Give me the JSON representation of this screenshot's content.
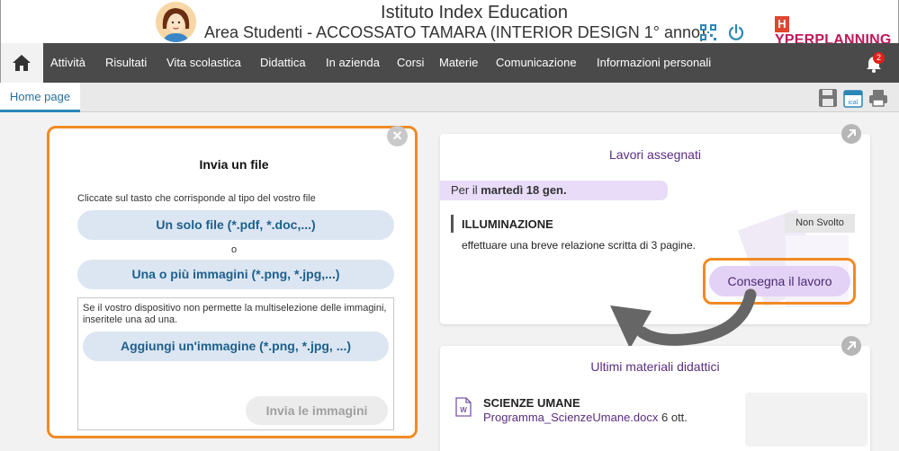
{
  "header": {
    "institute": "Istituto Index Education",
    "area": "Area Studenti - ACCOSSATO TAMARA (INTERIOR DESIGN  1° anno)",
    "brand_initial": "H",
    "brand_rest": "YPERPLANNING",
    "notifications_count": "2"
  },
  "nav": {
    "items": [
      "Attività",
      "Risultati",
      "Vita scolastica",
      "Didattica",
      "In azienda",
      "Corsi",
      "Materie",
      "Comunicazione",
      "Informazioni personali"
    ]
  },
  "subnav": {
    "tab": "Home page"
  },
  "dialog": {
    "title": "Invia un file",
    "hint": "Cliccate sul tasto che corrisponde al tipo del vostro file",
    "single_file": "Un solo file (*.pdf, *.doc,...)",
    "or": "o",
    "images": "Una o più immagini (*.png, *.jpg,...)",
    "note": "Se il vostro dispositivo non permette la multiselezione delle immagini, inseritele una ad una.",
    "add_image": "Aggiungi un'immagine (*.png, *.jpg, ...)",
    "send_images": "Invia le immagini"
  },
  "assigned": {
    "title": "Lavori assegnati",
    "date_prefix": "Per il ",
    "date": "martedì 18 gen.",
    "subject": "ILLUMINAZIONE",
    "status": "Non Svolto",
    "description": "effettuare una breve relazione scritta di 3 pagine.",
    "deliver": "Consegna il lavoro"
  },
  "materials": {
    "title": "Ultimi materiali didattici",
    "subject": "SCIENZE UMANE",
    "file": "Programma_ScienzeUmane.docx",
    "date": "6 ott."
  },
  "colors": {
    "accent_orange": "#f08a24",
    "nav_bg": "#4a4a4a",
    "purple": "#5a2d82",
    "blue": "#1f5f8b"
  }
}
